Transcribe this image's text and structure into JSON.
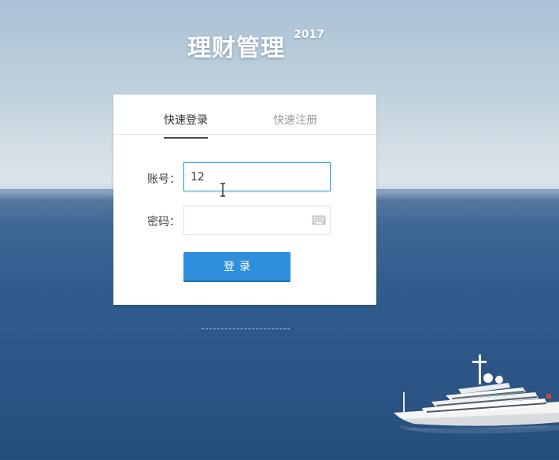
{
  "brand": {
    "title": "理财管理",
    "year": "2017"
  },
  "login_card": {
    "tabs": [
      {
        "label": "快速登录",
        "active": true
      },
      {
        "label": "快速注册",
        "active": false
      }
    ],
    "account": {
      "label": "账号：",
      "value": "12"
    },
    "password": {
      "label": "密码：",
      "value": "",
      "keyboard_icon": "keyboard-icon"
    },
    "submit_label": "登录"
  },
  "colors": {
    "accent": "#2f8fdc",
    "input_focus_border": "#3aa0e0",
    "sea": "#2b5485"
  }
}
